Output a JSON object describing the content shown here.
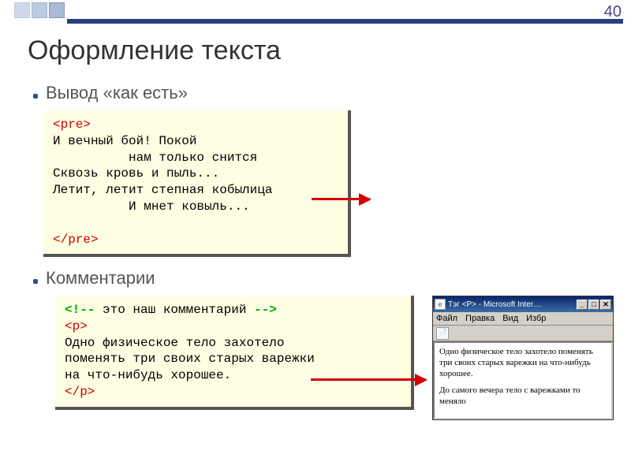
{
  "slide_number": "40",
  "title": "Оформление текста",
  "bullets": {
    "b1": "Вывод «как есть»",
    "b2": "Комментарии"
  },
  "code1": {
    "open_tag": "<pre>",
    "body": "И вечный бой! Покой\n          нам только снится\nСквозь кровь и пыль...\nЛетит, летит степная кобылица\n          И мнет ковыль...\n",
    "close_tag": "</pre>"
  },
  "code2": {
    "comment_open": "<!--",
    "comment_text": " это наш комментарий ",
    "comment_close": "-->",
    "p_open": "<p>",
    "body": "Одно физическое тело захотело\nпоменять три своих старых варежки\nна что-нибудь хорошее.",
    "p_close": "</p>"
  },
  "browser": {
    "title": "Тэг <P> - Microsoft Inter…",
    "menu": {
      "file": "Файл",
      "edit": "Правка",
      "view": "Вид",
      "fav": "Избр"
    },
    "btn_min": "_",
    "btn_max": "□",
    "btn_close": "✕",
    "doc_icon": "📄",
    "paragraph1": "Одно физическое тело захотело поменять три своих старых варежки на что-нибудь хорошее.",
    "paragraph2": "До самого вечера тело с варежками то меняло"
  }
}
